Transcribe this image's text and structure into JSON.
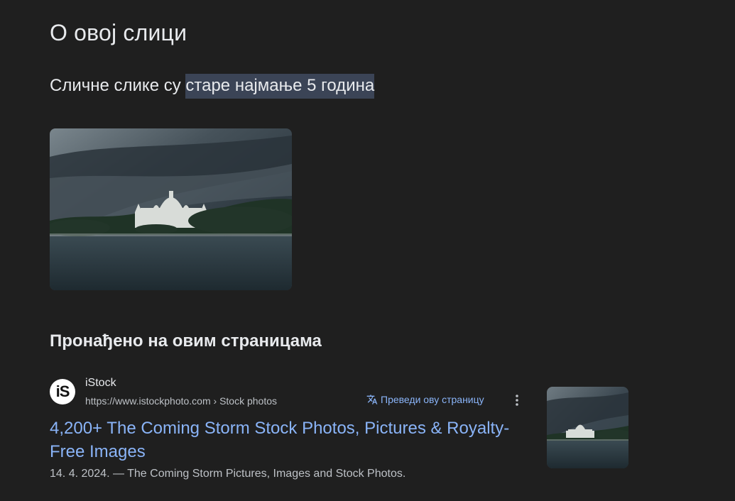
{
  "about": {
    "title": "О овој слици"
  },
  "similar": {
    "prefix": "Сличне слике су ",
    "highlight": "старе најмање 5 година"
  },
  "found": {
    "title": "Пронађено на овим страницама"
  },
  "results": [
    {
      "site_name": "iStock",
      "logo_text": "iS",
      "url": "https://www.istockphoto.com › Stock photos",
      "translate_label": "Преведи ову страницу",
      "title": "4,200+ The Coming Storm Stock Photos, Pictures & Royalty-Free Images",
      "snippet": "14. 4. 2024. — The Coming Storm Pictures, Images and Stock Photos."
    }
  ],
  "icons": {
    "translate": "translate-icon",
    "more": "more-vert-icon"
  },
  "colors": {
    "background": "#1f1f1f",
    "link": "#8ab4f8",
    "highlight": "#3b4456",
    "text": "#e8eaed",
    "muted": "#bdc1c6"
  }
}
